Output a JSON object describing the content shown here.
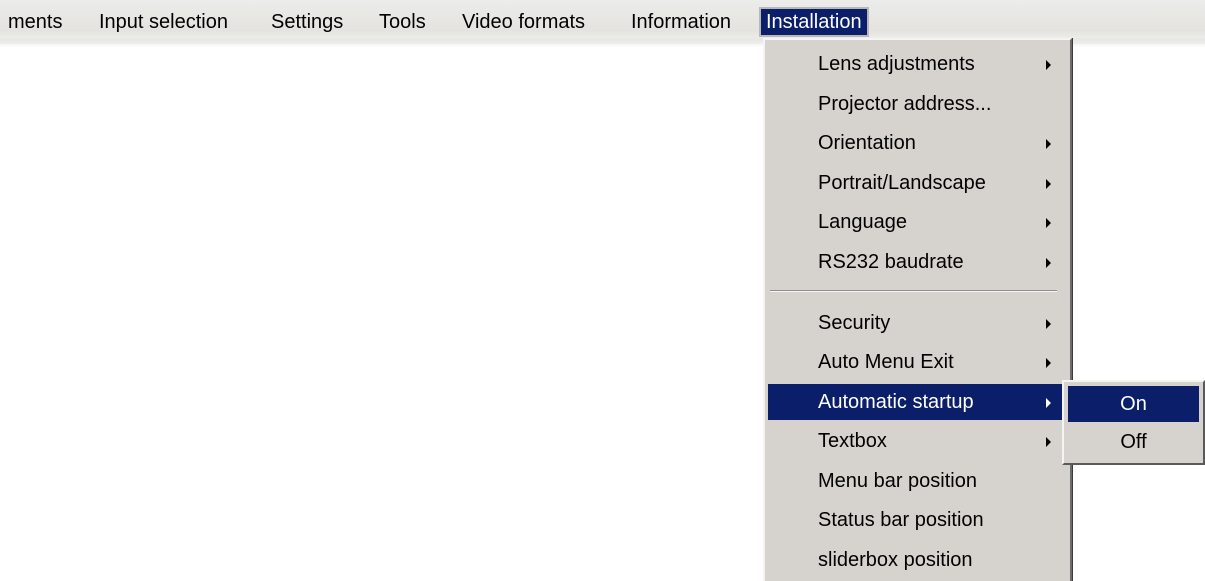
{
  "menubar": {
    "items": [
      {
        "label": "ments"
      },
      {
        "label": "Input selection"
      },
      {
        "label": "Settings"
      },
      {
        "label": "Tools"
      },
      {
        "label": "Video formats"
      },
      {
        "label": "Information"
      },
      {
        "label": "Installation"
      }
    ],
    "active_index": 6
  },
  "installation_menu": {
    "items": [
      {
        "label": "Lens adjustments",
        "submenu_arrow": true
      },
      {
        "label": "Projector address...",
        "submenu_arrow": false
      },
      {
        "label": "Orientation",
        "submenu_arrow": true
      },
      {
        "label": "Portrait/Landscape",
        "submenu_arrow": true
      },
      {
        "label": "Language",
        "submenu_arrow": true
      },
      {
        "label": "RS232 baudrate",
        "submenu_arrow": true
      },
      {
        "label": "Security",
        "submenu_arrow": true
      },
      {
        "label": "Auto Menu Exit",
        "submenu_arrow": true
      },
      {
        "label": "Automatic startup",
        "submenu_arrow": true
      },
      {
        "label": "Textbox",
        "submenu_arrow": true
      },
      {
        "label": "Menu bar position",
        "submenu_arrow": false
      },
      {
        "label": "Status bar position",
        "submenu_arrow": false
      },
      {
        "label": "sliderbox position",
        "submenu_arrow": false
      }
    ],
    "highlighted_index": 8
  },
  "automatic_startup_submenu": {
    "items": [
      {
        "label": "On"
      },
      {
        "label": "Off"
      }
    ],
    "highlighted_index": 0
  },
  "colors": {
    "highlight": "#0a1e69",
    "menu_background": "#d6d3ce"
  }
}
